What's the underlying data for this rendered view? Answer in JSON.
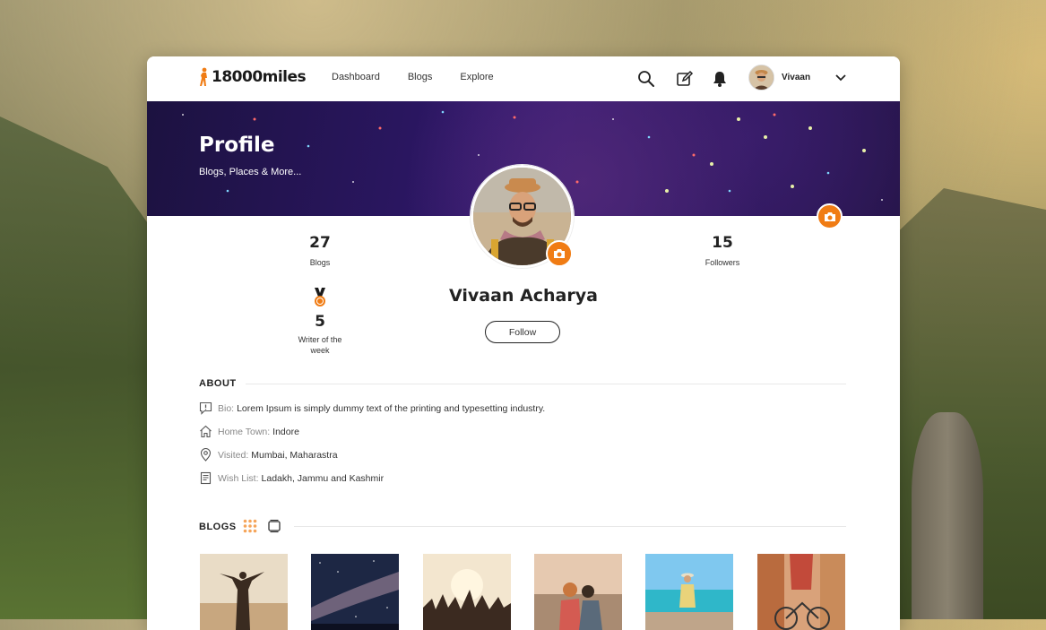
{
  "header": {
    "logo_text": "18000miles",
    "nav": [
      "Dashboard",
      "Blogs",
      "Explore"
    ],
    "user_name": "Vivaan"
  },
  "banner": {
    "title": "Profile",
    "subtitle": "Blogs, Places & More..."
  },
  "profile": {
    "name": "Vivaan Acharya",
    "follow_label": "Follow",
    "blogs_count": "27",
    "blogs_label": "Blogs",
    "followers_count": "15",
    "followers_label": "Followers",
    "award_count": "5",
    "award_label_line1": "Writer of the",
    "award_label_line2": "week"
  },
  "about": {
    "title": "ABOUT",
    "items": [
      {
        "key": "Bio:",
        "value": "Lorem Ipsum is simply dummy text of the printing and typesetting industry."
      },
      {
        "key": "Home Town:",
        "value": "Indore"
      },
      {
        "key": "Visited:",
        "value": "Mumbai, Maharastra"
      },
      {
        "key": "Wish List:",
        "value": "Ladakh, Jammu and Kashmir"
      }
    ]
  },
  "blogs": {
    "title": "BLOGS"
  },
  "colors": {
    "accent": "#f07c14",
    "banner": "#2a1660"
  }
}
